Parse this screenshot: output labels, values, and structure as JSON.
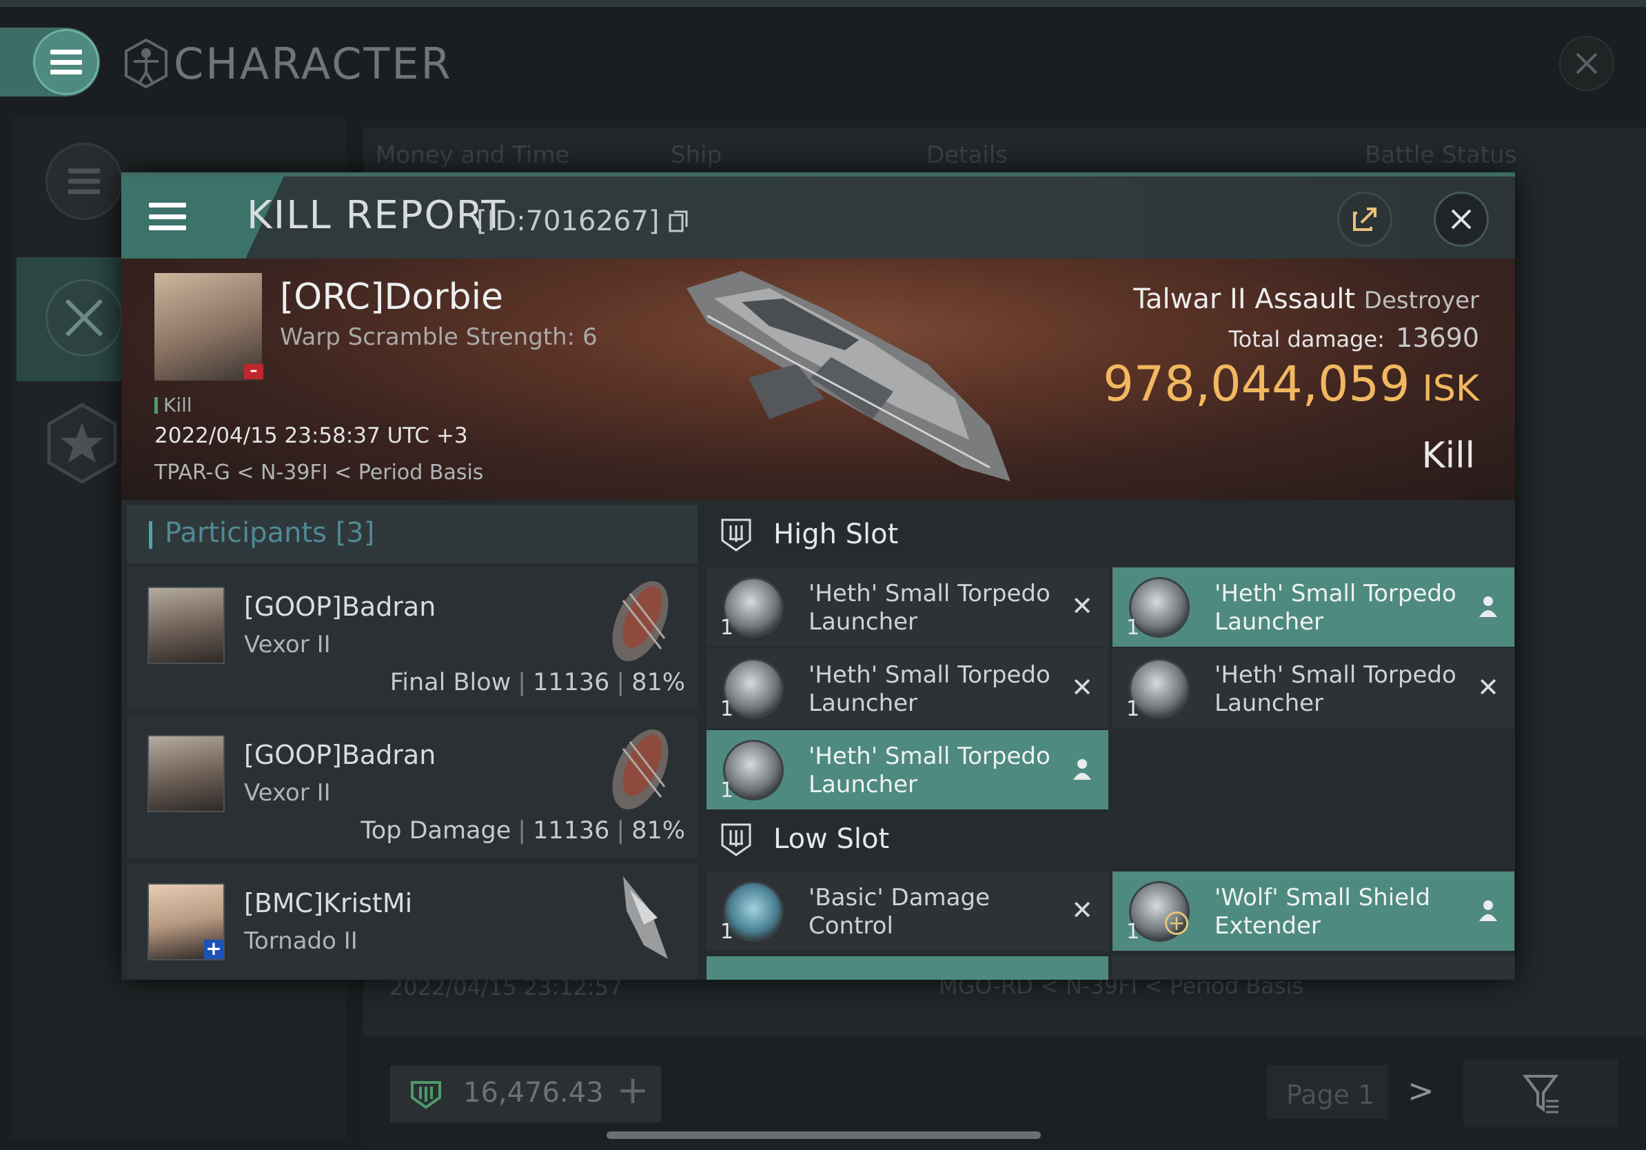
{
  "background": {
    "window_title": "CHARACTER",
    "columns": [
      "Money and Time",
      "Ship",
      "Details",
      "Battle Status"
    ],
    "row": {
      "date": "2022/04/15  23:12:57",
      "location": "MGO-RD < N-39FI < Period Basis"
    },
    "wallet": "16,476.43",
    "page": "Page 1"
  },
  "kill_report": {
    "title": "KILL REPORT",
    "id": "[ID:7016267]",
    "victim": {
      "name": "[ORC]Dorbie",
      "warp_scramble": "Warp Scramble Strength: 6",
      "tag": "Kill",
      "datetime": "2022/04/15 23:58:37 UTC +3",
      "location": "TPAR-G < N-39FI < Period Basis"
    },
    "ship": {
      "name": "Talwar II Assault",
      "class": "Destroyer"
    },
    "total_damage_label": "Total damage:",
    "total_damage": "13690",
    "isk_value": "978,044,059",
    "isk_unit": "ISK",
    "result": "Kill",
    "participants": {
      "label": "Participants",
      "count": "[3]",
      "rows": [
        {
          "name": "[GOOP]Badran",
          "ship": "Vexor II",
          "role": "Final Blow",
          "damage": "11136",
          "percent": "81%"
        },
        {
          "name": "[GOOP]Badran",
          "ship": "Vexor II",
          "role": "Top Damage",
          "damage": "11136",
          "percent": "81%"
        },
        {
          "name": "[BMC]KristMi",
          "ship": "Tornado II"
        }
      ]
    },
    "high_slot": {
      "label": "High Slot",
      "modules": [
        {
          "name": "'Heth' Small Torpedo Launcher",
          "qty": "1",
          "status": "destroyed"
        },
        {
          "name": "'Heth' Small Torpedo Launcher",
          "qty": "1",
          "status": "dropped"
        },
        {
          "name": "'Heth' Small Torpedo Launcher",
          "qty": "1",
          "status": "destroyed"
        },
        {
          "name": "'Heth' Small Torpedo Launcher",
          "qty": "1",
          "status": "destroyed"
        },
        {
          "name": "'Heth' Small Torpedo Launcher",
          "qty": "1",
          "status": "dropped"
        }
      ]
    },
    "low_slot": {
      "label": "Low Slot",
      "modules": [
        {
          "name": "'Basic' Damage Control",
          "qty": "1",
          "status": "destroyed"
        },
        {
          "name": "'Wolf' Small Shield Extender",
          "qty": "1",
          "status": "dropped"
        }
      ]
    }
  },
  "colors": {
    "accent": "#4f8a80",
    "isk": "#f1b860",
    "banner": "#5b3326"
  }
}
